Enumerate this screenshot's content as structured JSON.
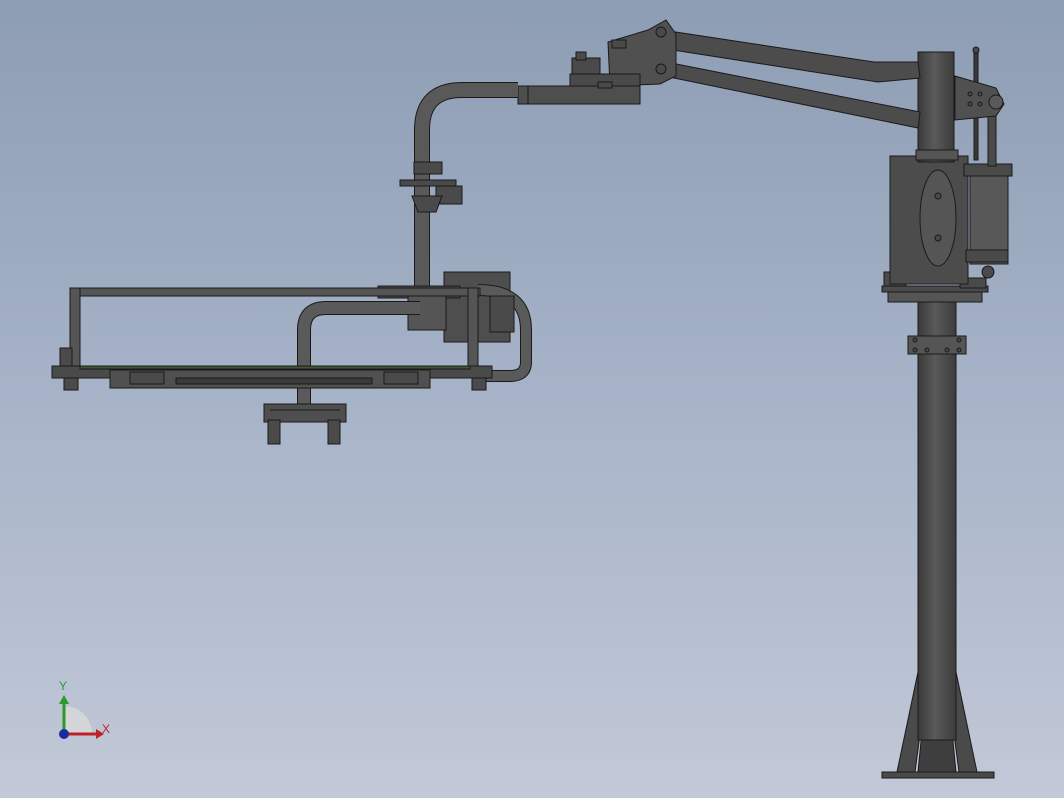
{
  "viewport": {
    "background_top": "#8d9db4",
    "background_bottom": "#c2c9d8",
    "model_color": "#4a4a4a",
    "edge_color": "#1a1a1a"
  },
  "triad": {
    "x_label": "X",
    "y_label": "Y",
    "x_color": "#c0202a",
    "y_color": "#2a9a2a",
    "origin_color": "#1a2aa0"
  }
}
